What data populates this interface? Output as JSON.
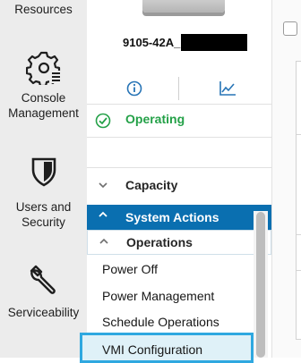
{
  "left_nav": {
    "items": [
      {
        "label": "Resources",
        "icon": "resources-icon"
      },
      {
        "label": "Console\nManagement",
        "icon": "gear-list-icon"
      },
      {
        "label": "Users and\nSecurity",
        "icon": "shield-icon"
      },
      {
        "label": "Serviceability",
        "icon": "wrench-icon"
      }
    ]
  },
  "server": {
    "name": "9105-42A_",
    "status": "Operating",
    "tabs": [
      {
        "icon": "info-icon"
      },
      {
        "icon": "chart-icon"
      }
    ]
  },
  "sections": {
    "capacity": "Capacity",
    "system_actions": "System Actions",
    "operations": "Operations"
  },
  "operations_menu": [
    "Power Off",
    "Power Management",
    "Schedule Operations",
    "VMI Configuration"
  ],
  "colors": {
    "accent_blue": "#0a6fb0",
    "status_green": "#24a148",
    "highlight_border": "#2fa8e0",
    "icon_blue": "#2774b6"
  }
}
